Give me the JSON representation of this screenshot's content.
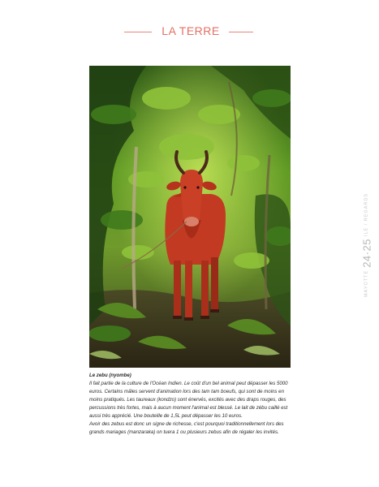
{
  "header": {
    "title": "LA TERRE"
  },
  "side_folio": {
    "left_text": "MAYOTTE",
    "page_numbers": "24·25",
    "right_text": "ILE / REGARDS"
  },
  "photo": {
    "alt_subject": "zebu"
  },
  "caption": {
    "title": "Le zebu (nyombe)",
    "paragraph1": "Il fait partie de la culture de l'Océan Indien. Le coût d'un bel animal peut dépasser les 5000 euros. Certains mâles servent d'animation lors des tam tam boeufs, qui sont de moins en moins pratiqués. Les taureaux (kondzo) sont énervés, excités avec des draps rouges, des percussions très fortes, mais à aucun moment l'animal est blessé. Le lait de zébu caillé est aussi très apprécié. Une bouteille de 1,5L peut dépasser les 10 euros.",
    "paragraph2": "Avoir des zebus est donc un signe de richesse, c'est pourquoi traditionnellement lors des grands mariages (manzaraka) on tuera 1 ou plusieurs zebus afin de régaler les invités."
  },
  "colors": {
    "accent": "#e46f64",
    "foliage_dark": "#1f3d12",
    "foliage_light": "#8fc23a",
    "zebu_red": "#c23a22"
  }
}
